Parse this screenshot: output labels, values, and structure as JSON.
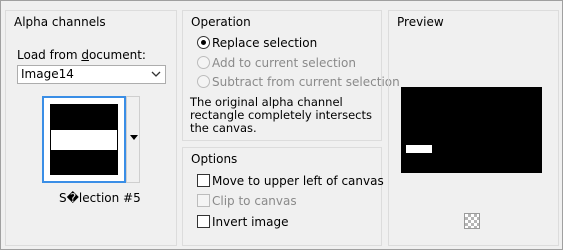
{
  "alpha_channels": {
    "title": "Alpha channels",
    "load_label": "Load from document:",
    "load_label_u": "d",
    "document_value": "Image14",
    "selection_name": "S�lection #5"
  },
  "operation": {
    "title": "Operation",
    "options": [
      {
        "label": "Replace selection",
        "selected": true,
        "enabled": true
      },
      {
        "label": "Add to current selection",
        "selected": false,
        "enabled": false
      },
      {
        "label": "Subtract from current selection",
        "selected": false,
        "enabled": false
      }
    ],
    "description": "The original alpha channel rectangle completely intersects the canvas."
  },
  "options": {
    "title": "Options",
    "items": [
      {
        "label": "Move to upper left of canvas",
        "checked": false,
        "enabled": true
      },
      {
        "label": "Clip to canvas",
        "checked": false,
        "enabled": false
      },
      {
        "label": "Invert image",
        "checked": false,
        "enabled": true
      }
    ]
  },
  "preview": {
    "title": "Preview"
  }
}
